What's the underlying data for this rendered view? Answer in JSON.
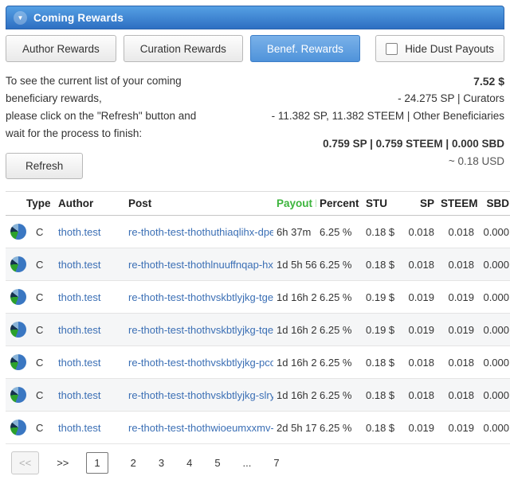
{
  "colors": {
    "accent_blue": "#3f7fd1",
    "link_blue": "#3b6fb5",
    "payout_green": "#3cb43c"
  },
  "panel": {
    "title": "Coming Rewards"
  },
  "tabs": [
    {
      "label": "Author Rewards",
      "active": false
    },
    {
      "label": "Curation Rewards",
      "active": false
    },
    {
      "label": "Benef. Rewards",
      "active": true
    }
  ],
  "hide_dust": {
    "label": "Hide Dust Payouts",
    "checked": false
  },
  "info": {
    "line1": "To see the current list of your coming",
    "line2": "beneficiary rewards,",
    "line3": "please click on the \"Refresh\" button and",
    "line4": "wait for the process to finish:",
    "total_usd": "7.52 $",
    "curators": "- 24.275 SP | Curators",
    "other_beneficiaries": "- 11.382 SP, 11.382 STEEM | Other Beneficiaries",
    "totals": "0.759 SP | 0.759 STEEM | 0.000 SBD",
    "approx": "~ 0.18 USD",
    "refresh_label": "Refresh"
  },
  "table": {
    "headers": {
      "type": "Type",
      "author": "Author",
      "post": "Post",
      "payout": "Payout In",
      "percent": "Percent",
      "stu": "STU",
      "sp": "SP",
      "steem": "STEEM",
      "sbd": "SBD"
    },
    "rows": [
      {
        "type": "C",
        "author": "thoth.test",
        "post": "re-thoth-test-thothuthiaqlihx-dpe",
        "payout": "6h 37m",
        "percent": "6.25 %",
        "stu": "0.18 $",
        "sp": "0.018",
        "steem": "0.018",
        "sbd": "0.000"
      },
      {
        "type": "C",
        "author": "thoth.test",
        "post": "re-thoth-test-thothlnuuffnqap-hx",
        "payout": "1d 5h 56",
        "percent": "6.25 %",
        "stu": "0.18 $",
        "sp": "0.018",
        "steem": "0.018",
        "sbd": "0.000"
      },
      {
        "type": "C",
        "author": "thoth.test",
        "post": "re-thoth-test-thothvskbtlyjkg-tge",
        "payout": "1d 16h 2",
        "percent": "6.25 %",
        "stu": "0.19 $",
        "sp": "0.019",
        "steem": "0.019",
        "sbd": "0.000"
      },
      {
        "type": "C",
        "author": "thoth.test",
        "post": "re-thoth-test-thothvskbtlyjkg-tqe",
        "payout": "1d 16h 2",
        "percent": "6.25 %",
        "stu": "0.19 $",
        "sp": "0.019",
        "steem": "0.019",
        "sbd": "0.000"
      },
      {
        "type": "C",
        "author": "thoth.test",
        "post": "re-thoth-test-thothvskbtlyjkg-pco",
        "payout": "1d 16h 2",
        "percent": "6.25 %",
        "stu": "0.18 $",
        "sp": "0.018",
        "steem": "0.018",
        "sbd": "0.000"
      },
      {
        "type": "C",
        "author": "thoth.test",
        "post": "re-thoth-test-thothvskbtlyjkg-slry",
        "payout": "1d 16h 2",
        "percent": "6.25 %",
        "stu": "0.18 $",
        "sp": "0.018",
        "steem": "0.018",
        "sbd": "0.000"
      },
      {
        "type": "C",
        "author": "thoth.test",
        "post": "re-thoth-test-thothwioeumxxmv-",
        "payout": "2d 5h 17",
        "percent": "6.25 %",
        "stu": "0.18 $",
        "sp": "0.019",
        "steem": "0.019",
        "sbd": "0.000"
      }
    ]
  },
  "pagination": {
    "first_label": "<<",
    "next_label": ">>",
    "pages": [
      "1",
      "2",
      "3",
      "4",
      "5",
      "...",
      "7"
    ],
    "active": "1"
  }
}
